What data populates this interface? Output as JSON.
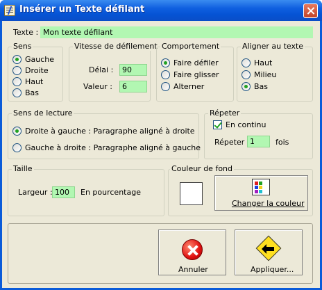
{
  "window": {
    "title": "Insérer un Texte défilant"
  },
  "texte": {
    "label": "Texte :",
    "value": "Mon texte défilant"
  },
  "sens": {
    "title": "Sens",
    "options": [
      {
        "label": "Gauche",
        "selected": true
      },
      {
        "label": "Droite",
        "selected": false
      },
      {
        "label": "Haut",
        "selected": false
      },
      {
        "label": "Bas",
        "selected": false
      }
    ]
  },
  "vitesse": {
    "title": "Vitesse de défilement",
    "delai_label": "Délai :",
    "delai_value": "90",
    "valeur_label": "Valeur :",
    "valeur_value": "6"
  },
  "comportement": {
    "title": "Comportement",
    "options": [
      {
        "label": "Faire défiler",
        "selected": true
      },
      {
        "label": "Faire glisser",
        "selected": false
      },
      {
        "label": "Alterner",
        "selected": false
      }
    ]
  },
  "aligner": {
    "title": "Aligner au texte",
    "options": [
      {
        "label": "Haut",
        "selected": false
      },
      {
        "label": "Milieu",
        "selected": false
      },
      {
        "label": "Bas",
        "selected": true
      }
    ]
  },
  "lecture": {
    "title": "Sens de lecture",
    "options": [
      {
        "label": "Droite à gauche : Paragraphe aligné à droite",
        "selected": true
      },
      {
        "label": "Gauche à droite : Paragraphe aligné à gauche",
        "selected": false
      }
    ]
  },
  "repeter": {
    "title": "Répeter",
    "continu_label": "En continu",
    "continu_checked": true,
    "repeter_label": "Répeter :",
    "repeter_value": "1",
    "fois_label": "fois"
  },
  "taille": {
    "title": "Taille",
    "largeur_label": "Largeur :",
    "largeur_value": "100",
    "unit_label": "En pourcentage"
  },
  "fond": {
    "title": "Couleur de fond",
    "swatch_color": "#ffffff",
    "button_label": "Changer la couleur"
  },
  "actions": {
    "cancel_label": "Annuler",
    "apply_label": "Appliquer..."
  },
  "colors": {
    "field_bg": "#b2f7b2",
    "dialog_bg": "#ece9d8",
    "titlebar": "#0553d4"
  }
}
